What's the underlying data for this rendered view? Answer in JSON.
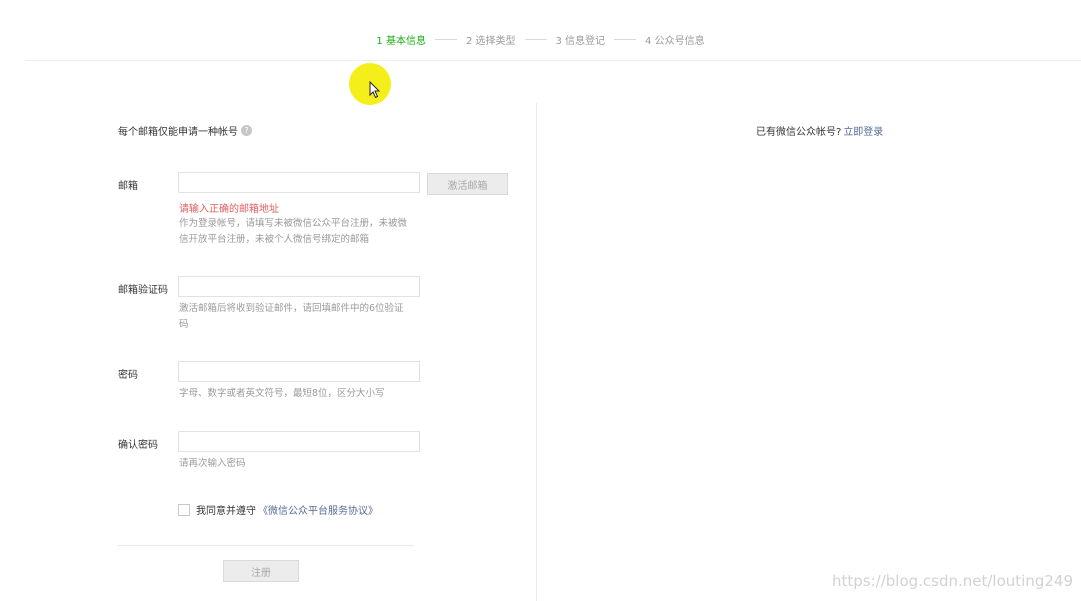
{
  "steps": [
    {
      "label": "1 基本信息",
      "active": true
    },
    {
      "label": "2 选择类型",
      "active": false
    },
    {
      "label": "3 信息登记",
      "active": false
    },
    {
      "label": "4 公众号信息",
      "active": false
    }
  ],
  "form": {
    "tip": "每个邮箱仅能申请一种帐号",
    "help_icon": "?",
    "email": {
      "label": "邮箱",
      "value": "",
      "activate_button": "激活邮箱",
      "error": "请输入正确的邮箱地址",
      "hint": "作为登录帐号，请填写未被微信公众平台注册，未被微信开放平台注册，未被个人微信号绑定的邮箱"
    },
    "code": {
      "label": "邮箱验证码",
      "value": "",
      "hint": "激活邮箱后将收到验证邮件，请回填邮件中的6位验证码"
    },
    "password": {
      "label": "密码",
      "value": "",
      "hint": "字母、数字或者英文符号，最短8位，区分大小写"
    },
    "confirm_password": {
      "label": "确认密码",
      "value": "",
      "hint": "请再次输入密码"
    },
    "agreement": {
      "checked": false,
      "text": "我同意并遵守",
      "link": "《微信公众平台服务协议》"
    },
    "register_button": "注册"
  },
  "side": {
    "prompt": "已有微信公众帐号?",
    "login_link": "立即登录"
  },
  "watermark": "https://blog.csdn.net/louting249",
  "colors": {
    "accent": "#1aad19",
    "link": "#576b95",
    "error": "#e15f5f",
    "cursor_highlight": "#f4ef1a"
  }
}
